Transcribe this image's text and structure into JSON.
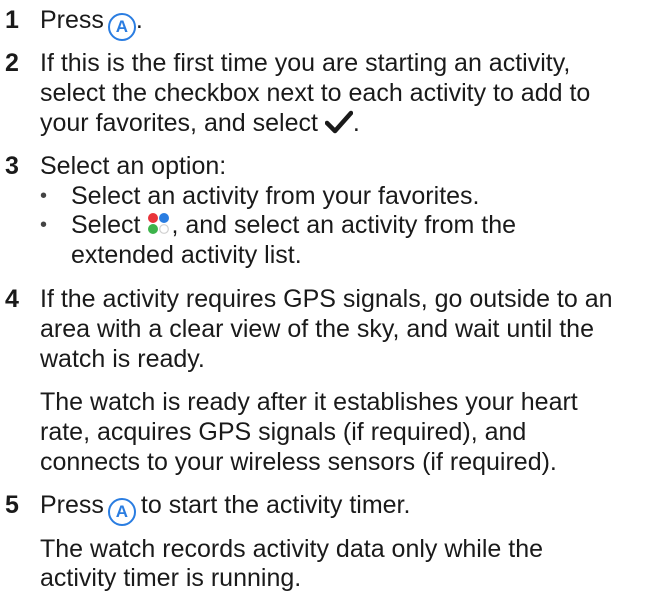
{
  "steps": [
    {
      "number": "1",
      "lines": [
        "Press",
        "."
      ],
      "icon": "a-button-icon"
    },
    {
      "number": "2",
      "lines": [
        "If this is the first time you are starting an activity,",
        "select the checkbox next to each activity to add to",
        "your favorites, and select",
        "."
      ],
      "icon": "checkmark-icon"
    },
    {
      "number": "3",
      "lines": [
        "Select an option:"
      ],
      "bullets": [
        {
          "lines": [
            "Select an activity from your favorites."
          ]
        },
        {
          "lines": [
            "Select",
            ", and select an activity from the",
            "extended activity list."
          ],
          "icon": "more-activities-dots-icon"
        }
      ]
    },
    {
      "number": "4",
      "lines": [
        "If the activity requires GPS signals, go outside to an",
        "area with a clear view of the sky, and wait until the",
        "watch is ready."
      ],
      "note_lines": [
        "The watch is ready after it establishes your heart",
        "rate, acquires GPS signals (if required), and",
        "connects to your wireless sensors (if required)."
      ]
    },
    {
      "number": "5",
      "lines": [
        "Press",
        "to start the activity timer."
      ],
      "icon": "a-button-icon",
      "note_lines": [
        "The watch records activity data only while the",
        "activity timer is running."
      ]
    }
  ],
  "button_letter": "A",
  "bullet_char": "•",
  "colors": {
    "text": "#1a1a1a",
    "accent_blue": "#2a7de1",
    "dot_red": "#e8343a",
    "dot_blue": "#2a7de1",
    "dot_green": "#3cb34a"
  }
}
